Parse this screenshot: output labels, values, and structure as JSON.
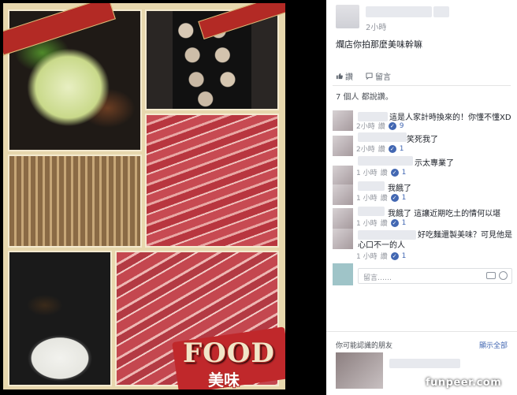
{
  "post": {
    "time": "2小時",
    "text": "爛店你拍那麼美味幹嘛",
    "actions": {
      "like": "讚",
      "comment": "留言"
    },
    "seen": "7 個人 都說讚。"
  },
  "comments": [
    {
      "text": "這是人家計時換來的！你懂不懂XD",
      "time": "2小時",
      "like": "讚",
      "reply": "回覆",
      "likes": "9"
    },
    {
      "text": "笑死我了",
      "time": "2小時",
      "like": "讚",
      "reply": "回覆",
      "likes": "1"
    },
    {
      "text": "示太專業了",
      "time": "1 小時",
      "like": "讚",
      "reply": "回覆",
      "likes": "1"
    },
    {
      "text": "我餓了",
      "time": "1 小時",
      "like": "讚",
      "reply": "回覆",
      "likes": "1"
    },
    {
      "text": "我餓了 這讓近期吃土的情何以堪",
      "time": "1 小時",
      "like": "讚",
      "reply": "回覆",
      "likes": "1"
    },
    {
      "text": "好吃麵還製美味？可見他是心口不一的人",
      "time": "1 小時",
      "like": "讚",
      "reply": "回覆",
      "likes": "1"
    }
  ],
  "reply": {
    "placeholder": "留言……"
  },
  "pymk": {
    "title": "你可能認識的朋友",
    "see_all": "顯示全部"
  },
  "overlay": {
    "food_word": "FOOD",
    "food_sub": "美味",
    "watermark": "funpeer.com"
  },
  "colors": {
    "facebook_blue": "#4267b2",
    "ribbon_red": "#b32a25"
  }
}
